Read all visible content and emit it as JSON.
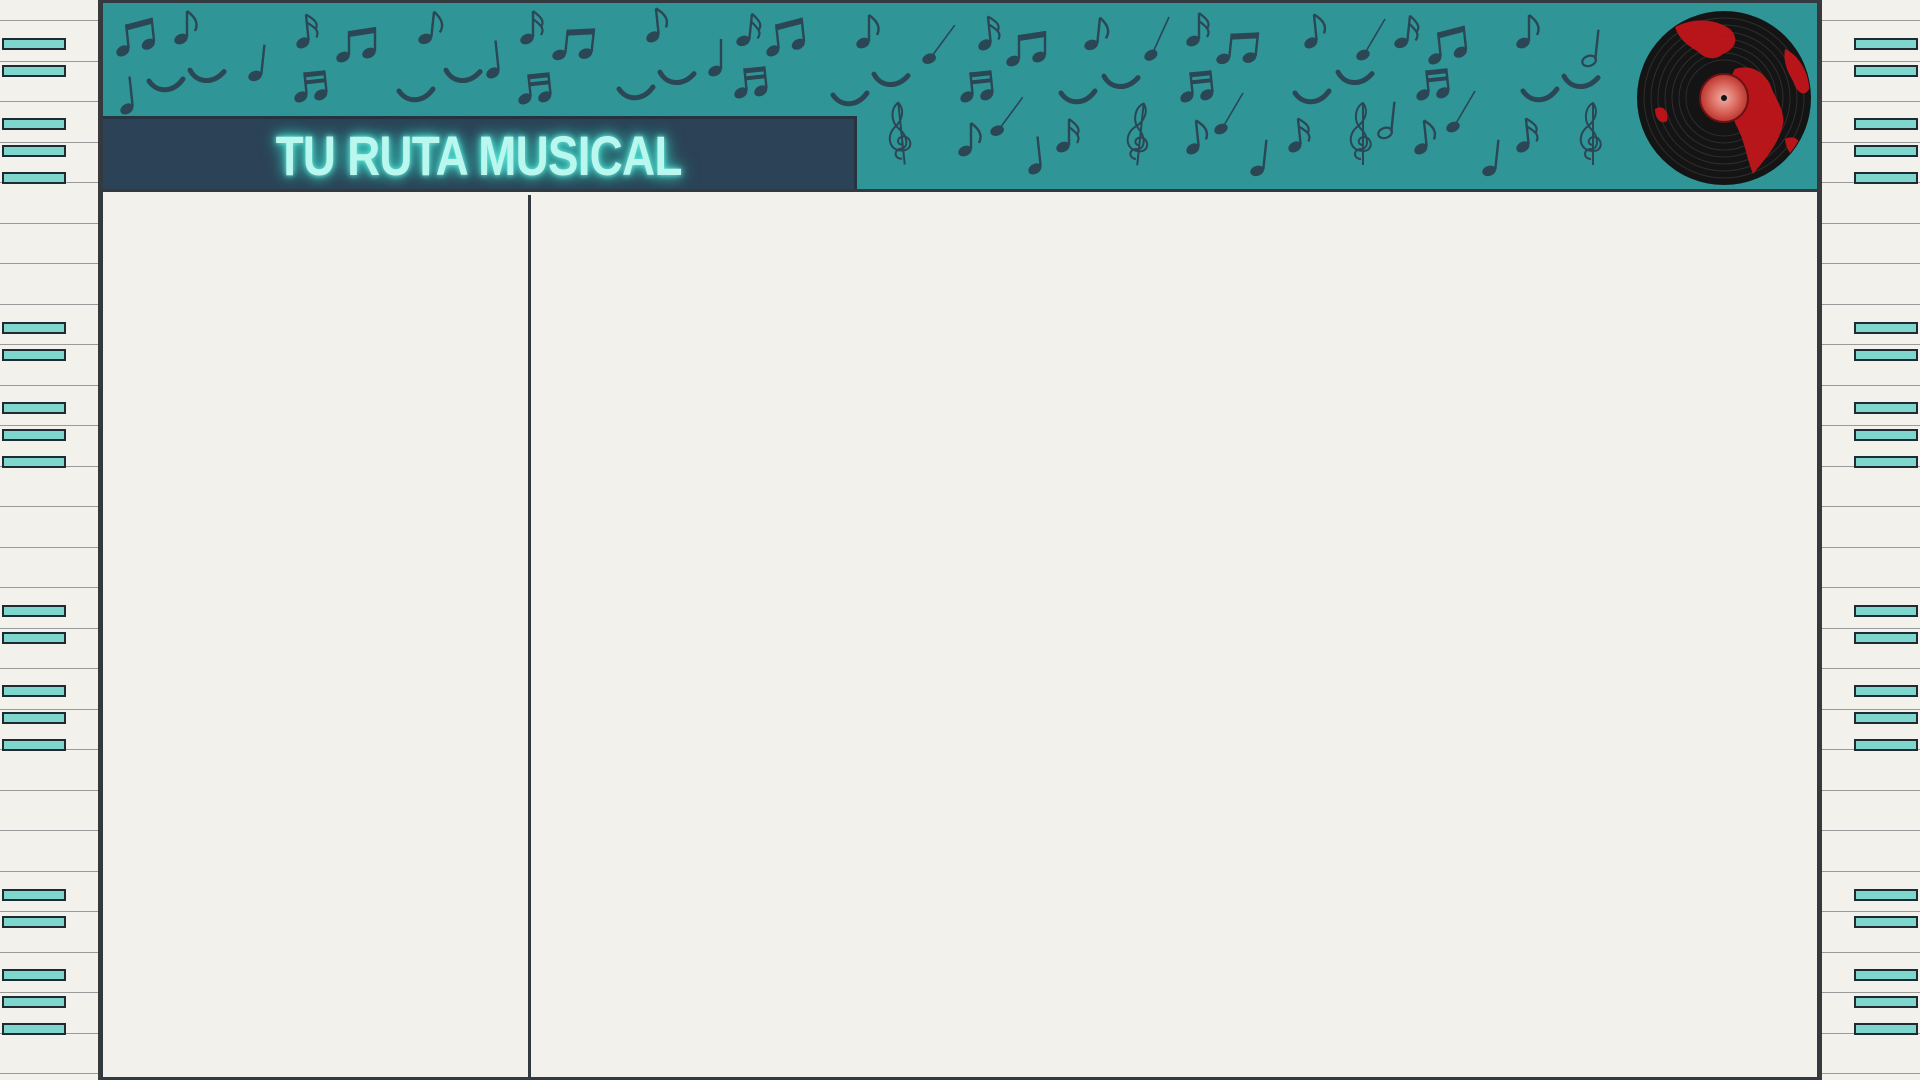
{
  "app": {
    "title": "TU RUTA MUSICAL"
  },
  "header": {
    "background_color": "#2f9596",
    "note_color": "#2b4654",
    "decoration_icon": "music-notes-icon",
    "logo_icon": "vinyl-record-globe-icon"
  },
  "title_box": {
    "background_color": "#2c4256",
    "text_color": "#b9f7ef",
    "glow_color": "#3fd9ca"
  },
  "piano": {
    "key_color": "#7fd6cc",
    "icon": "piano-keys-icon"
  },
  "panels": {
    "sidebar": {},
    "content": {}
  }
}
